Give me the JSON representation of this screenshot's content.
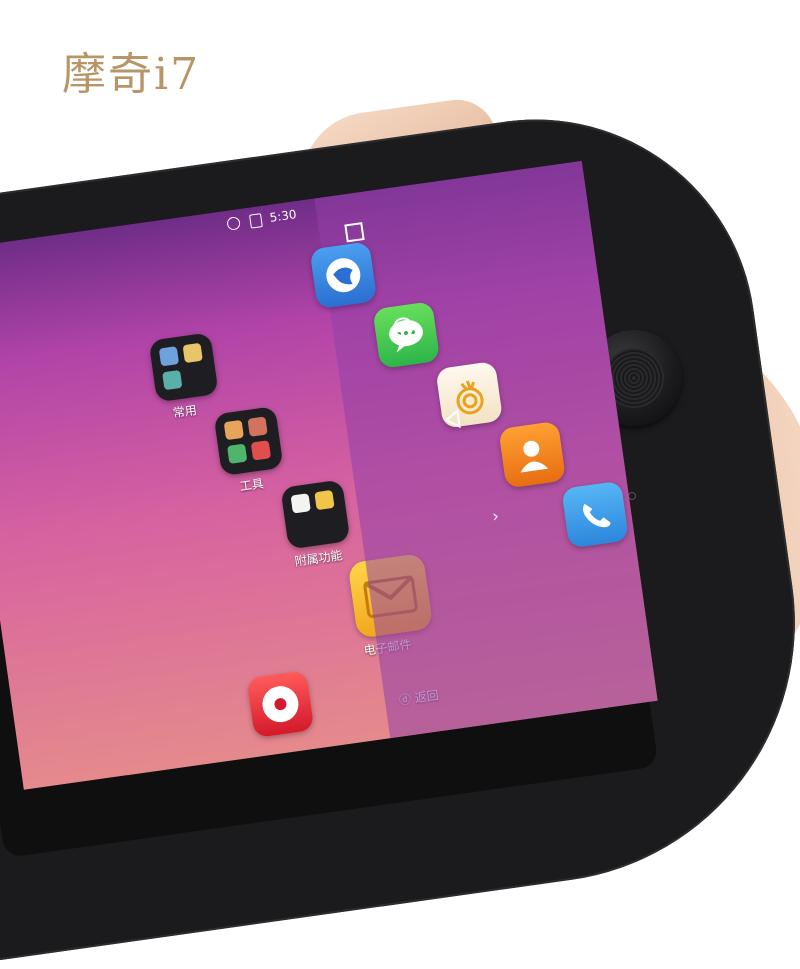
{
  "brand": {
    "name": "摩奇i7"
  },
  "status_bar": {
    "time": "5:30"
  },
  "home": {
    "folders": [
      {
        "label": "常用"
      },
      {
        "label": "工具"
      },
      {
        "label": "附属功能"
      },
      {
        "label": "电子邮件"
      }
    ],
    "back_label": "返回"
  },
  "dock_apps": [
    {
      "name": "browser-app"
    },
    {
      "name": "messaging-app"
    },
    {
      "name": "theme-app"
    },
    {
      "name": "contacts-app"
    },
    {
      "name": "phone-app"
    }
  ],
  "nav_buttons": [
    "recents",
    "home",
    "back",
    "expand"
  ],
  "colors": {
    "brand_text": "#b89567",
    "body": "#1b1b1d",
    "gold_trim": "#e9c1a7"
  }
}
